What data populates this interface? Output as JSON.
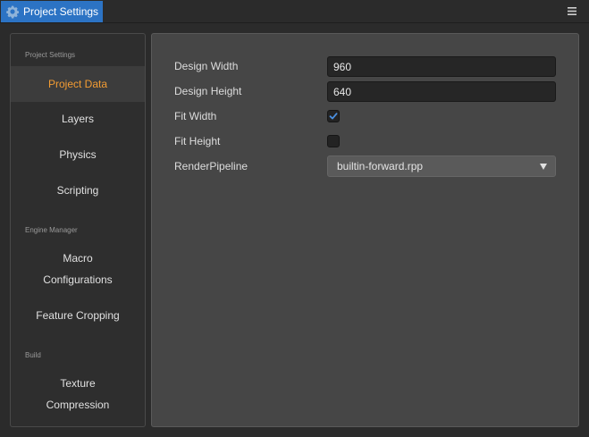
{
  "window": {
    "tab_title": "Project Settings",
    "tab_icon": "gear-icon",
    "menu_icon": "hamburger-menu-icon",
    "accent": "#2c73c4"
  },
  "sidebar": {
    "groups": [
      {
        "label": "Project Settings",
        "items": [
          {
            "label": "Project Data",
            "active": true
          },
          {
            "label": "Layers"
          },
          {
            "label": "Physics"
          },
          {
            "label": "Scripting"
          }
        ]
      },
      {
        "label": "Engine Manager",
        "items": [
          {
            "label_line1": "Macro",
            "label_line2": "Configurations"
          },
          {
            "label": "Feature Cropping"
          }
        ]
      },
      {
        "label": "Build",
        "items": [
          {
            "label_line1": "Texture",
            "label_line2": "Compression"
          }
        ]
      }
    ],
    "active_color": "#f39c33"
  },
  "project_data": {
    "design_width": {
      "label": "Design Width",
      "value": "960"
    },
    "design_height": {
      "label": "Design Height",
      "value": "640"
    },
    "fit_width": {
      "label": "Fit Width",
      "checked": true
    },
    "fit_height": {
      "label": "Fit Height",
      "checked": false
    },
    "render_pipeline": {
      "label": "RenderPipeline",
      "value": "builtin-forward.rpp"
    }
  }
}
